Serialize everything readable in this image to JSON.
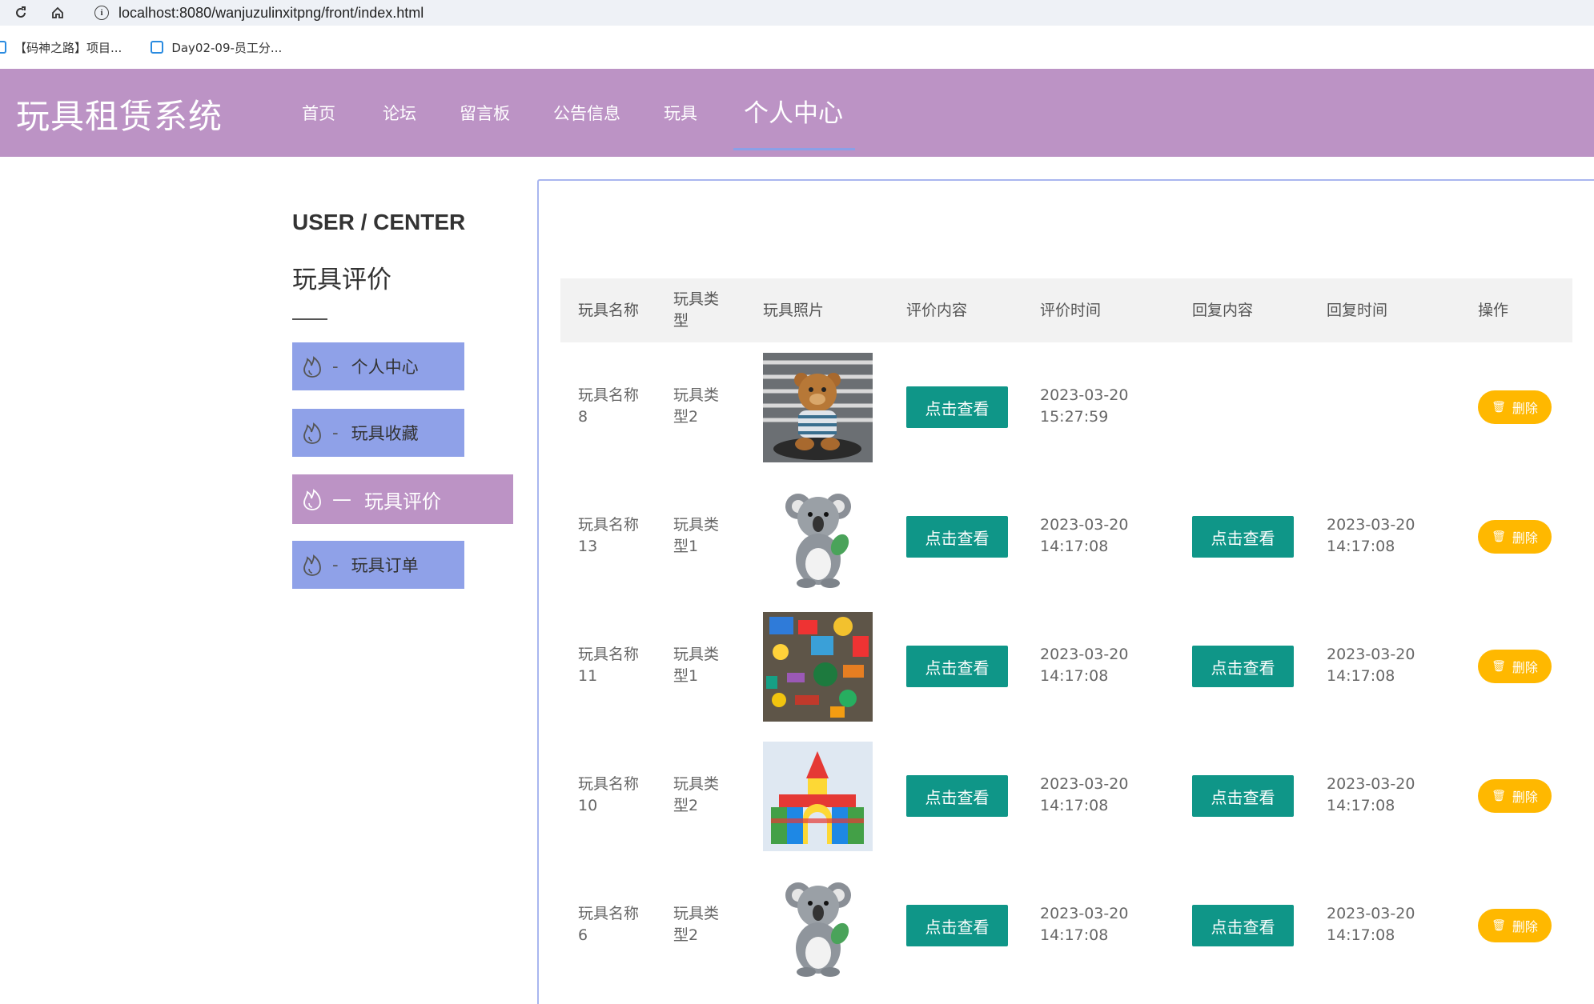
{
  "browser": {
    "url": "localhost:8080/wanjuzulinxitpng/front/index.html",
    "bookmarks": [
      "【码神之路】项目...",
      "Day02-09-员工分..."
    ]
  },
  "header": {
    "title": "玩具租赁系统",
    "nav": [
      "首页",
      "论坛",
      "留言板",
      "公告信息",
      "玩具",
      "个人中心"
    ],
    "active_nav": "个人中心"
  },
  "sidebar": {
    "title": "USER / CENTER",
    "section": "玩具评价",
    "items": [
      {
        "label": "个人中心",
        "dash": "-"
      },
      {
        "label": "玩具收藏",
        "dash": "-"
      },
      {
        "label": "玩具评价",
        "dash": "—"
      },
      {
        "label": "玩具订单",
        "dash": "-"
      }
    ]
  },
  "table": {
    "columns": [
      "玩具名称",
      "玩具类\n型",
      "玩具照片",
      "评价内容",
      "评价时间",
      "回复内容",
      "回复时间",
      "操作"
    ],
    "view_label": "点击查看",
    "delete_label": "删除",
    "rows": [
      {
        "name": "玩具名称\n8",
        "type": "玩具类\n型2",
        "photo": "teddy-bear-photo",
        "eval_time": "2023-03-20\n15:27:59",
        "reply": "",
        "reply_time": ""
      },
      {
        "name": "玩具名称\n13",
        "type": "玩具类\n型1",
        "photo": "koala-plush-photo",
        "eval_time": "2023-03-20\n14:17:08",
        "reply": "点击查看",
        "reply_time": "2023-03-20\n14:17:08"
      },
      {
        "name": "玩具名称\n11",
        "type": "玩具类\n型1",
        "photo": "assorted-toys-photo",
        "eval_time": "2023-03-20\n14:17:08",
        "reply": "点击查看",
        "reply_time": "2023-03-20\n14:17:08"
      },
      {
        "name": "玩具名称\n10",
        "type": "玩具类\n型2",
        "photo": "building-blocks-photo",
        "eval_time": "2023-03-20\n14:17:08",
        "reply": "点击查看",
        "reply_time": "2023-03-20\n14:17:08"
      },
      {
        "name": "玩具名称\n6",
        "type": "玩具类\n型2",
        "photo": "koala-plush-photo",
        "eval_time": "2023-03-20\n14:17:08",
        "reply": "点击查看",
        "reply_time": "2023-03-20\n14:17:08"
      }
    ]
  },
  "colors": {
    "header_bg": "#bc93c5",
    "sidebar_item": "#8fa1e8",
    "sidebar_active": "#bc93c5",
    "view_button": "#0f9688",
    "delete_button": "#ffb800"
  }
}
